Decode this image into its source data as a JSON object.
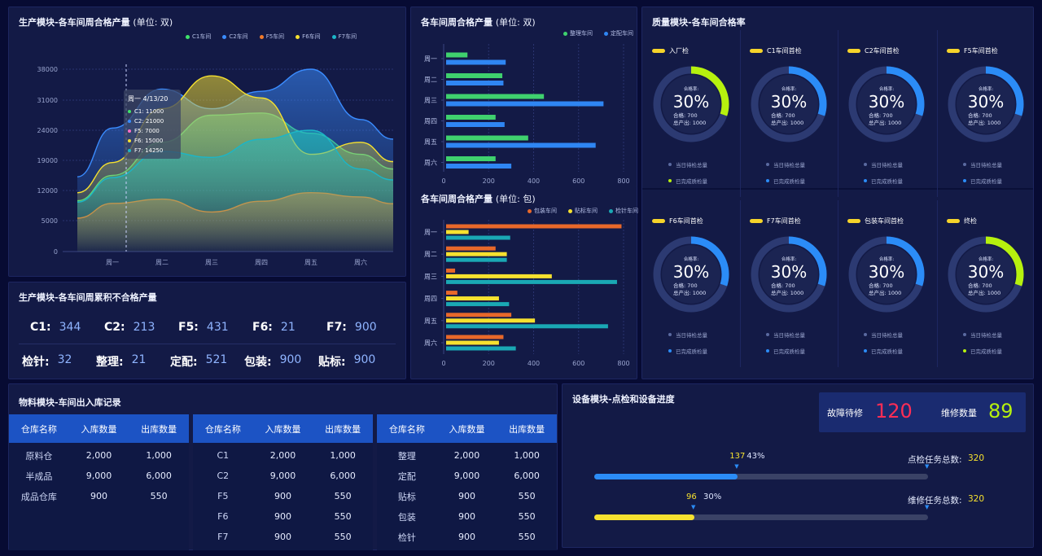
{
  "production_panel": {
    "title": "生产模块-各车间周合格产量",
    "title_unit": "(单位: 双)",
    "legend": [
      "C1车间",
      "C2车间",
      "F5车间",
      "F6车间",
      "F7车间"
    ],
    "tooltip": {
      "title": "周一 4/13/20",
      "items": [
        "C1: 11000",
        "C2: 21000",
        "F5: 7000",
        "F6: 15000",
        "F7: 14250"
      ]
    }
  },
  "chart_data": [
    {
      "type": "area",
      "title": "生产模块-各车间周合格产量",
      "categories": [
        "周一",
        "周二",
        "周三",
        "周四",
        "周五",
        "周六"
      ],
      "y_ticks": [
        "0",
        "5000",
        "12000",
        "19000",
        "24000",
        "31000",
        "38000"
      ],
      "series": [
        {
          "name": "C1车间",
          "color": "#3fe36a",
          "values": [
            15500,
            22000,
            27500,
            28000,
            23500,
            20000
          ]
        },
        {
          "name": "C2车间",
          "color": "#3a8cff",
          "values": [
            24500,
            33500,
            29000,
            33000,
            39500,
            26500
          ]
        },
        {
          "name": "F5车间",
          "color": "#f07a2a",
          "values": [
            9000,
            10000,
            7000,
            9500,
            11500,
            10500
          ]
        },
        {
          "name": "F6车间",
          "color": "#f6e12f",
          "values": [
            18500,
            29000,
            36500,
            31500,
            20000,
            22000
          ]
        },
        {
          "name": "F7车间",
          "color": "#1bb6c8",
          "values": [
            15000,
            20500,
            19500,
            22500,
            24000,
            17000
          ]
        }
      ]
    },
    {
      "type": "bar",
      "title": "各车间周合格产量",
      "categories": [
        "周一",
        "周二",
        "周三",
        "周四",
        "周五",
        "周六"
      ],
      "x_ticks": [
        "0",
        "200",
        "400",
        "600",
        "800"
      ],
      "xlim": [
        0,
        800
      ],
      "series": [
        {
          "name": "整理车间",
          "color": "#3fd16e",
          "values": [
            95,
            250,
            435,
            220,
            365,
            220
          ]
        },
        {
          "name": "定配车间",
          "color": "#2f86f3",
          "values": [
            265,
            255,
            700,
            260,
            665,
            290
          ]
        }
      ]
    },
    {
      "type": "bar",
      "title": "各车间周合格产量",
      "categories": [
        "周一",
        "周二",
        "周三",
        "周四",
        "周五",
        "周六"
      ],
      "x_ticks": [
        "0",
        "200",
        "400",
        "600",
        "800"
      ],
      "xlim": [
        0,
        800
      ],
      "series": [
        {
          "name": "包装车间",
          "color": "#e8682a",
          "values": [
            780,
            220,
            40,
            50,
            290,
            255
          ]
        },
        {
          "name": "贴标车间",
          "color": "#f6e12f",
          "values": [
            100,
            270,
            470,
            235,
            395,
            235
          ]
        },
        {
          "name": "检针车间",
          "color": "#1aa8b4",
          "values": [
            285,
            270,
            760,
            280,
            720,
            310
          ]
        }
      ]
    }
  ],
  "bar_panel1": {
    "title": "各车间周合格产量",
    "title_unit": "(单位: 双)",
    "legend": [
      "整理车间",
      "定配车间"
    ]
  },
  "bar_panel2": {
    "title": "各车间周合格产量",
    "title_unit": "(单位: 包)",
    "legend": [
      "包装车间",
      "贴标车间",
      "检针车间"
    ]
  },
  "defect_panel": {
    "title": "生产模块-各车间周累积不合格产量",
    "row1": [
      {
        "label": "C1:",
        "value": "344"
      },
      {
        "label": "C2:",
        "value": "213"
      },
      {
        "label": "F5:",
        "value": "431"
      },
      {
        "label": "F6:",
        "value": "21"
      },
      {
        "label": "F7:",
        "value": "900"
      }
    ],
    "row2": [
      {
        "label": "检针:",
        "value": "32"
      },
      {
        "label": "整理:",
        "value": "21"
      },
      {
        "label": "定配:",
        "value": "521"
      },
      {
        "label": "包装:",
        "value": "900"
      },
      {
        "label": "贴标:",
        "value": "900"
      }
    ]
  },
  "quality_panel": {
    "title": "质量模块-各车间合格率",
    "cells": [
      {
        "label": "入厂检",
        "rate": "30%",
        "rate_value": 0.3,
        "rate_label": "合格率:",
        "pass": "合格: 700",
        "total": "总产出: 1000",
        "arc_color": "#b6f10e",
        "legend": [
          "当日待检总量",
          "已完成质检量"
        ],
        "legend_color": "#b6f10e"
      },
      {
        "label": "C1车间首检",
        "rate": "30%",
        "rate_value": 0.3,
        "rate_label": "合格率:",
        "pass": "合格: 700",
        "total": "总产出: 1000",
        "arc_color": "#2b8cf7",
        "legend": [
          "当日待检总量",
          "已完成质检量"
        ],
        "legend_color": "#2b8cf7"
      },
      {
        "label": "C2车间首检",
        "rate": "30%",
        "rate_value": 0.3,
        "rate_label": "合格率:",
        "pass": "合格: 700",
        "total": "总产出: 1000",
        "arc_color": "#2b8cf7",
        "legend": [
          "当日待检总量",
          "已完成质检量"
        ],
        "legend_color": "#2b8cf7"
      },
      {
        "label": "F5车间首检",
        "rate": "30%",
        "rate_value": 0.3,
        "rate_label": "合格率:",
        "pass": "合格: 700",
        "total": "总产出: 1000",
        "arc_color": "#2b8cf7",
        "legend": [
          "当日待检总量",
          "已完成质检量"
        ],
        "legend_color": "#2b8cf7"
      },
      {
        "label": "F6车间首检",
        "rate": "30%",
        "rate_value": 0.3,
        "rate_label": "合格率:",
        "pass": "合格: 700",
        "total": "总产出: 1000",
        "arc_color": "#2b8cf7",
        "legend": [
          "当日待检总量",
          "已完成质检量"
        ],
        "legend_color": "#2b8cf7"
      },
      {
        "label": "F7车间首检",
        "rate": "30%",
        "rate_value": 0.3,
        "rate_label": "合格率:",
        "pass": "合格: 700",
        "total": "总产出: 1000",
        "arc_color": "#2b8cf7",
        "legend": [
          "当日待检总量",
          "已完成质检量"
        ],
        "legend_color": "#2b8cf7"
      },
      {
        "label": "包装车间首检",
        "rate": "30%",
        "rate_value": 0.3,
        "rate_label": "合格率:",
        "pass": "合格: 700",
        "total": "总产出: 1000",
        "arc_color": "#2b8cf7",
        "legend": [
          "当日待检总量",
          "已完成质检量"
        ],
        "legend_color": "#2b8cf7"
      },
      {
        "label": "终检",
        "rate": "30%",
        "rate_value": 0.3,
        "rate_label": "合格率:",
        "pass": "合格: 700",
        "total": "总产出: 1000",
        "arc_color": "#b6f10e",
        "legend": [
          "当日待检总量",
          "已完成质检量"
        ],
        "legend_color": "#b6f10e"
      }
    ]
  },
  "material_panel": {
    "title": "物料模块-车间出入库记录",
    "headers": [
      "仓库名称",
      "入库数量",
      "出库数量"
    ],
    "tables": [
      [
        [
          "原料仓",
          "2,000",
          "1,000"
        ],
        [
          "半成品",
          "9,000",
          "6,000"
        ],
        [
          "成品仓库",
          "900",
          "550"
        ]
      ],
      [
        [
          "C1",
          "2,000",
          "1,000"
        ],
        [
          "C2",
          "9,000",
          "6,000"
        ],
        [
          "F5",
          "900",
          "550"
        ],
        [
          "F6",
          "900",
          "550"
        ],
        [
          "F7",
          "900",
          "550"
        ]
      ],
      [
        [
          "整理",
          "2,000",
          "1,000"
        ],
        [
          "定配",
          "9,000",
          "6,000"
        ],
        [
          "贴标",
          "900",
          "550"
        ],
        [
          "包装",
          "900",
          "550"
        ],
        [
          "检针",
          "900",
          "550"
        ]
      ]
    ]
  },
  "equipment_panel": {
    "title": "设备模块-点检和设备进度",
    "fault_label": "故障待修",
    "fault_value": "120",
    "repair_label": "维修数量",
    "repair_value": "89",
    "progress": [
      {
        "done": "137",
        "pct": "43%",
        "pct_value": 0.43,
        "total_label": "点检任务总数:",
        "total": "320",
        "color": "#2b8cf7"
      },
      {
        "done": "96",
        "pct": "30%",
        "pct_value": 0.3,
        "total_label": "维修任务总数:",
        "total": "320",
        "color": "#f6e12f"
      }
    ]
  }
}
